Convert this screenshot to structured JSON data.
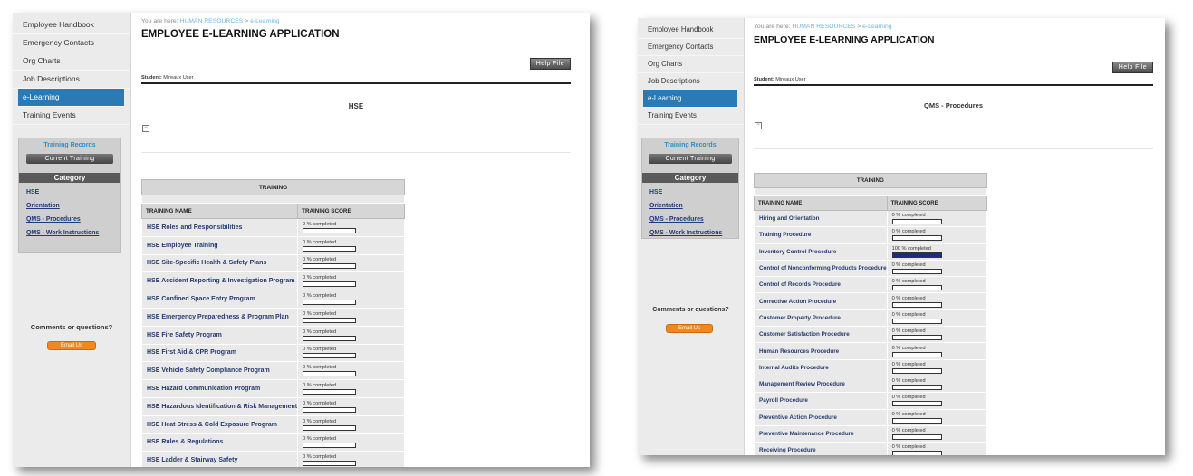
{
  "screens": [
    {
      "sidebar": {
        "nav": [
          {
            "label": "Employee Handbook",
            "active": false
          },
          {
            "label": "Emergency Contacts",
            "active": false
          },
          {
            "label": "Org Charts",
            "active": false
          },
          {
            "label": "Job Descriptions",
            "active": false
          },
          {
            "label": "e-Learning",
            "active": true
          },
          {
            "label": "Training Events",
            "active": false
          }
        ],
        "records_title": "Training Records",
        "current_training": "Current Training",
        "category_heading": "Category",
        "categories": [
          "HSE",
          "Orientation",
          "QMS - Procedures",
          "QMS - Work Instructions"
        ],
        "comments": "Comments or questions?",
        "email_label": "Email Us"
      },
      "main": {
        "breadcrumb_prefix": "You are here: ",
        "breadcrumb_section": "HUMAN RESOURCES",
        "breadcrumb_sep": " > ",
        "breadcrumb_page": "e-Learning",
        "title": "EMPLOYEE E-LEARNING APPLICATION",
        "help_label": "Help File",
        "student_label": "Student:",
        "student_name": "Mireaux User",
        "course_title": "HSE",
        "table_caption": "TRAINING",
        "col_name": "TRAINING NAME",
        "col_score": "TRAINING SCORE",
        "rows": [
          {
            "name": "HSE Roles and Responsibilities",
            "score": "0 % completed",
            "progress": 0
          },
          {
            "name": "HSE Employee Training",
            "score": "0 % completed",
            "progress": 0
          },
          {
            "name": "HSE Site-Specific Health & Safety Plans",
            "score": "0 % completed",
            "progress": 0
          },
          {
            "name": "HSE Accident Reporting & Investigation Program",
            "score": "0 % completed",
            "progress": 0
          },
          {
            "name": "HSE Confined Space Entry Program",
            "score": "0 % completed",
            "progress": 0
          },
          {
            "name": "HSE Emergency Preparedness & Program Plan",
            "score": "0 % completed",
            "progress": 0
          },
          {
            "name": "HSE Fire Safety Program",
            "score": "0 % completed",
            "progress": 0
          },
          {
            "name": "HSE First Aid & CPR Program",
            "score": "0 % completed",
            "progress": 0
          },
          {
            "name": "HSE Vehicle Safety Compliance Program",
            "score": "0 % completed",
            "progress": 0
          },
          {
            "name": "HSE Hazard Communication Program",
            "score": "0 % completed",
            "progress": 0
          },
          {
            "name": "HSE Hazardous Identification & Risk Management",
            "score": "0 % completed",
            "progress": 0
          },
          {
            "name": "HSE Heat Stress & Cold Exposure Program",
            "score": "0 % completed",
            "progress": 0
          },
          {
            "name": "HSE Rules & Regulations",
            "score": "0 % completed",
            "progress": 0
          },
          {
            "name": "HSE Ladder & Stairway Safety",
            "score": "0 % completed",
            "progress": 0
          }
        ]
      }
    },
    {
      "sidebar": {
        "nav": [
          {
            "label": "Employee Handbook",
            "active": false
          },
          {
            "label": "Emergency Contacts",
            "active": false
          },
          {
            "label": "Org Charts",
            "active": false
          },
          {
            "label": "Job Descriptions",
            "active": false
          },
          {
            "label": "e-Learning",
            "active": true
          },
          {
            "label": "Training Events",
            "active": false
          }
        ],
        "records_title": "Training Records",
        "current_training": "Current Training",
        "category_heading": "Category",
        "categories": [
          "HSE",
          "Orientation",
          "QMS - Procedures",
          "QMS - Work Instructions"
        ],
        "comments": "Comments or questions?",
        "email_label": "Email Us"
      },
      "main": {
        "breadcrumb_prefix": "You are here: ",
        "breadcrumb_section": "HUMAN RESOURCES",
        "breadcrumb_sep": " > ",
        "breadcrumb_page": "e-Learning",
        "title": "EMPLOYEE E-LEARNING APPLICATION",
        "help_label": "Help File",
        "student_label": "Student:",
        "student_name": "Mireaux User",
        "course_title": "QMS - Procedures",
        "table_caption": "TRAINING",
        "col_name": "TRAINING NAME",
        "col_score": "TRAINING SCORE",
        "rows": [
          {
            "name": "Hiring and Orientation",
            "score": "0 % completed",
            "progress": 0
          },
          {
            "name": "Training Procedure",
            "score": "0 % completed",
            "progress": 0
          },
          {
            "name": "Inventory Control Procedure",
            "score": "100 % completed",
            "progress": 100
          },
          {
            "name": "Control of Nonconforming Products Procedure",
            "score": "0 % completed",
            "progress": 0
          },
          {
            "name": "Control of Records Procedure",
            "score": "0 % completed",
            "progress": 0
          },
          {
            "name": "Corrective Action Procedure",
            "score": "0 % completed",
            "progress": 0
          },
          {
            "name": "Customer Property Procedure",
            "score": "0 % completed",
            "progress": 0
          },
          {
            "name": "Customer Satisfaction Procedure",
            "score": "0 % completed",
            "progress": 0
          },
          {
            "name": "Human Resources Procedure",
            "score": "0 % completed",
            "progress": 0
          },
          {
            "name": "Internal Audits Procedure",
            "score": "0 % completed",
            "progress": 0
          },
          {
            "name": "Management Review Procedure",
            "score": "0 % completed",
            "progress": 0
          },
          {
            "name": "Payroll Procedure",
            "score": "0 % completed",
            "progress": 0
          },
          {
            "name": "Preventive Action Procedure",
            "score": "0 % completed",
            "progress": 0
          },
          {
            "name": "Preventive Maintenance Procedure",
            "score": "0 % completed",
            "progress": 0
          },
          {
            "name": "Receiving Procedure",
            "score": "0 % completed",
            "progress": 0
          }
        ]
      }
    }
  ]
}
